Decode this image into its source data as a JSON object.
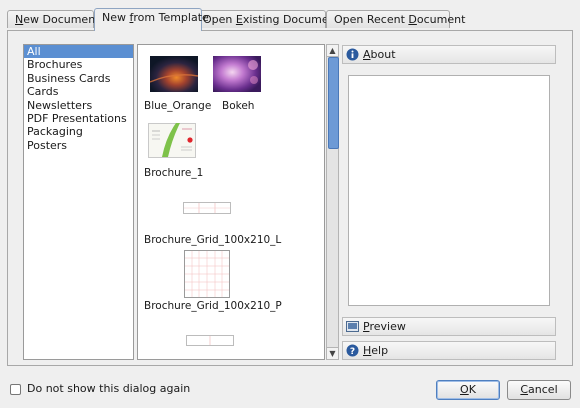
{
  "tabs": [
    {
      "label": "New Document",
      "mnemonic": "N",
      "rest": "ew Document"
    },
    {
      "label": "New from Template",
      "before": "New ",
      "mnemonic": "f",
      "rest": "rom Template"
    },
    {
      "label": "Open Existing Document",
      "before": "Open ",
      "mnemonic": "E",
      "rest": "xisting Document"
    },
    {
      "label": "Open Recent Document",
      "before": "Open Recent ",
      "mnemonic": "D",
      "rest": "ocument"
    }
  ],
  "active_tab": "New from Template",
  "categories": [
    "All",
    "Brochures",
    "Business Cards",
    "Cards",
    "Newsletters",
    "PDF Presentations",
    "Packaging",
    "Posters"
  ],
  "selected_category": "All",
  "templates": [
    "Blue_Orange",
    "Bokeh",
    "Brochure_1",
    "Brochure_Grid_100x210_L",
    "Brochure_Grid_100x210_P"
  ],
  "sections": {
    "about": {
      "mnemonic": "A",
      "rest": "bout"
    },
    "preview": {
      "mnemonic": "P",
      "rest": "review"
    },
    "help": {
      "mnemonic": "H",
      "rest": "elp"
    }
  },
  "checkbox_label": "Do not show this dialog again",
  "checkbox_checked": false,
  "buttons": {
    "ok": {
      "mnemonic": "O",
      "rest": "K"
    },
    "cancel": {
      "before": "",
      "mnemonic": "C",
      "rest": "ancel"
    }
  },
  "colors": {
    "selection": "#5b8fd2",
    "scroll_thumb": "#6d9ad6",
    "info_icon": "#2b5a9e"
  }
}
